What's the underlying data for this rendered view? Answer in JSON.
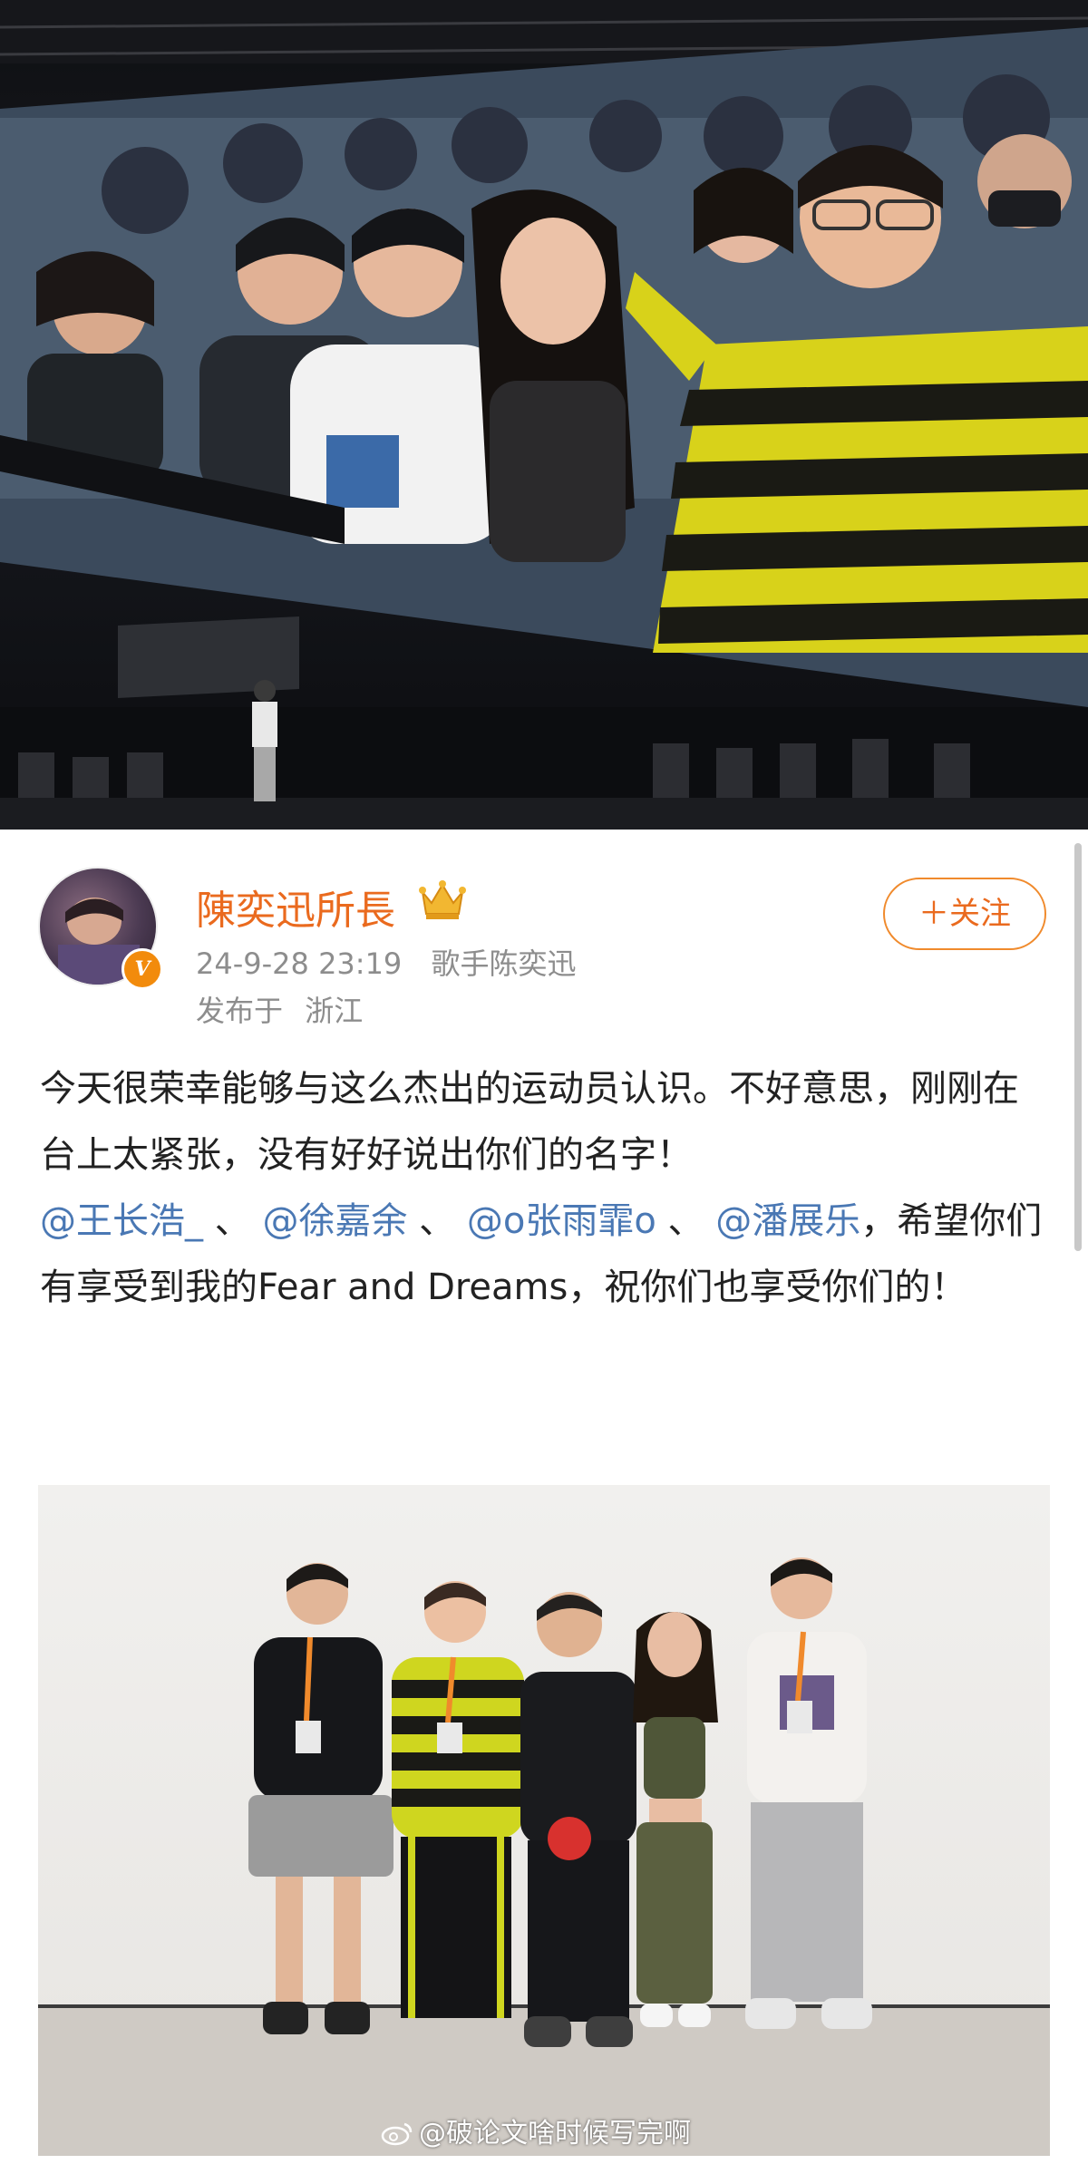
{
  "post": {
    "author": {
      "name": "陳奕迅所長",
      "badge": "V"
    },
    "timestamp": "24-9-28 23:19",
    "source": "歌手陈奕迅",
    "location_prefix": "发布于",
    "location": "浙江",
    "follow_label": "＋关注",
    "text": {
      "line1": "今天很荣幸能够与这么杰出的运动员认识。不好意思，刚刚在台上太紧张，没有好好说出你们的名字！",
      "mentions": [
        "@王长浩_",
        "@徐嘉余",
        "@o张雨霏o",
        "@潘展乐"
      ],
      "separator": "、",
      "after_mentions": "，希望你们有享受到我的Fear and Dreams，祝你们也享受你们的！"
    }
  },
  "watermark": "@破论文啥时候写完啊",
  "colors": {
    "accent": "#ea6a1e",
    "mention": "#4a78b4",
    "meta": "#8d8d8d",
    "badge": "#f28b0c"
  },
  "icons": [
    "crown-icon",
    "verified-badge",
    "weibo-icon"
  ]
}
